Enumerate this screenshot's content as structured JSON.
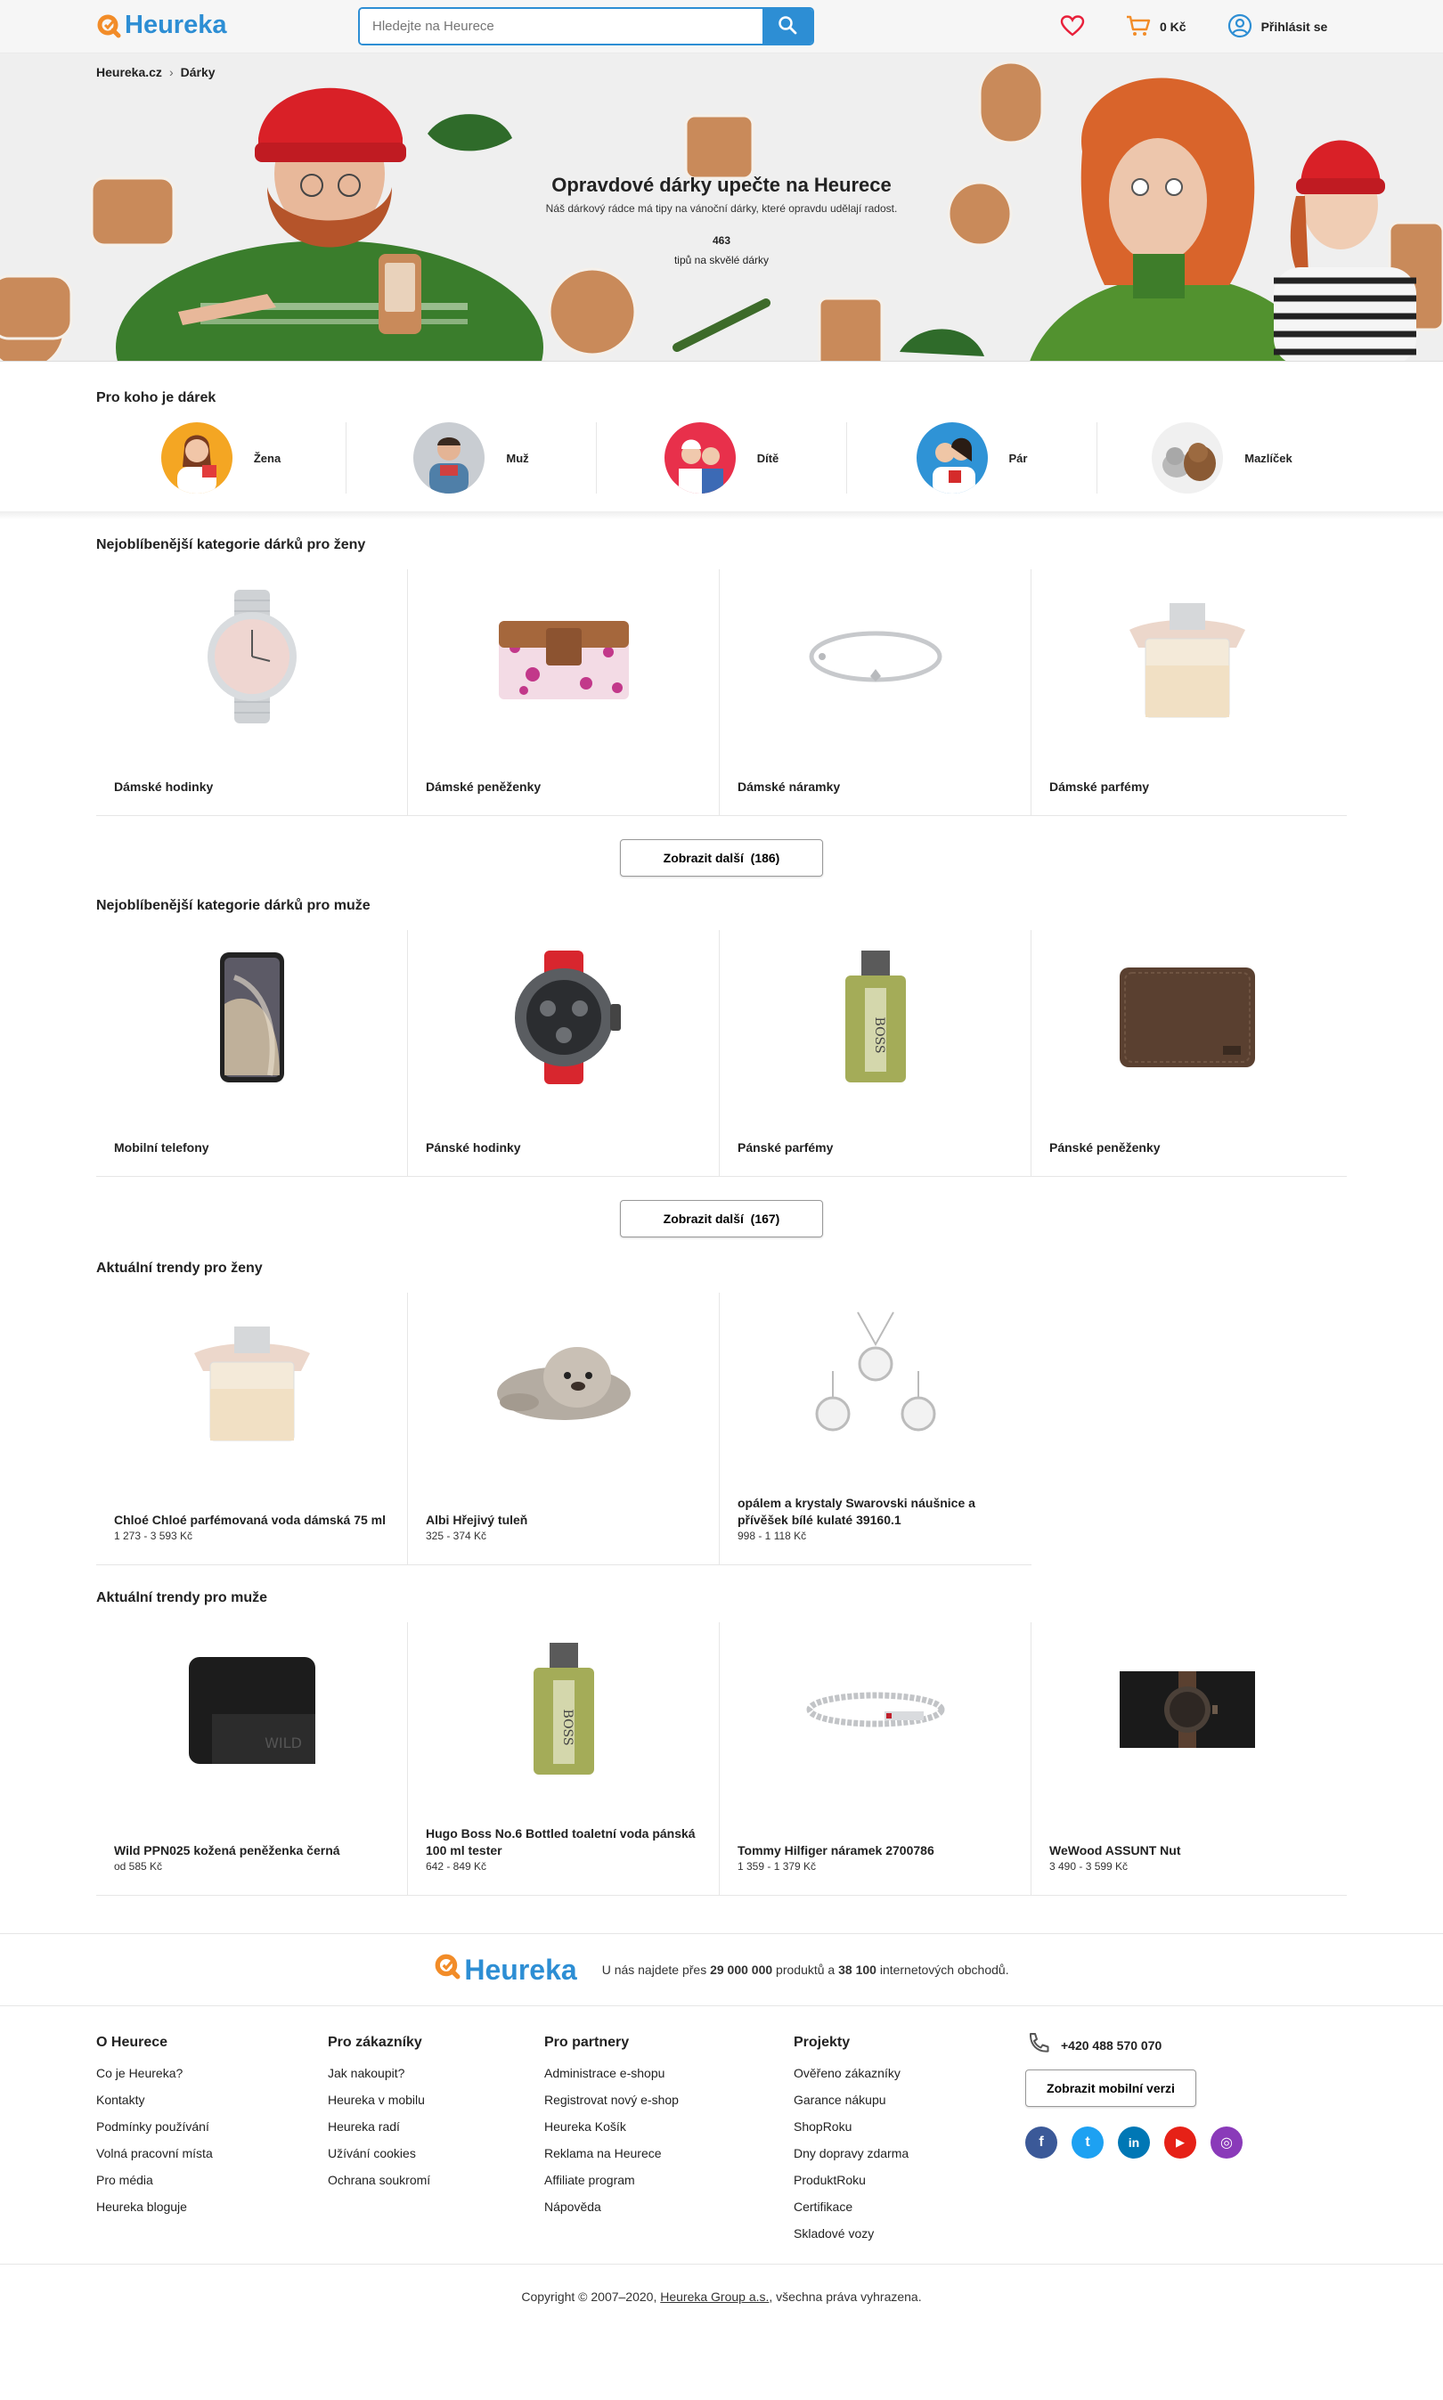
{
  "header": {
    "logo_text": "Heureka",
    "search_placeholder": "Hledejte na Heurece",
    "cart_total": "0 Kč",
    "login_label": "Přihlásit se",
    "accent_color": "#2d8ed4",
    "icons": [
      "heart-icon",
      "cart-icon",
      "user-icon",
      "search-icon"
    ]
  },
  "breadcrumb": [
    "Heureka.cz",
    "Dárky"
  ],
  "hero": {
    "title": "Opravdové dárky upečte na Heurece",
    "subtitle": "Náš dárkový rádce má tipy na vánoční dárky, které opravdu udělají radost.",
    "count": "463",
    "count_label": "tipů na skvělé dárky"
  },
  "recipients": {
    "title": "Pro koho je dárek",
    "items": [
      {
        "label": "Žena"
      },
      {
        "label": "Muž"
      },
      {
        "label": "Dítě"
      },
      {
        "label": "Pár"
      },
      {
        "label": "Mazlíček"
      }
    ]
  },
  "women_categories": {
    "title": "Nejoblíbenější kategorie dárků pro ženy",
    "items": [
      {
        "label": "Dámské hodinky"
      },
      {
        "label": "Dámské peněženky"
      },
      {
        "label": "Dámské náramky"
      },
      {
        "label": "Dámské parfémy"
      }
    ],
    "more_label": "Zobrazit další",
    "more_count": "(186)"
  },
  "men_categories": {
    "title": "Nejoblíbenější kategorie dárků pro muže",
    "items": [
      {
        "label": "Mobilní telefony"
      },
      {
        "label": "Pánské hodinky"
      },
      {
        "label": "Pánské parfémy"
      },
      {
        "label": "Pánské peněženky"
      }
    ],
    "more_label": "Zobrazit další",
    "more_count": "(167)"
  },
  "women_trends": {
    "title": "Aktuální trendy pro ženy",
    "items": [
      {
        "name": "Chloé Chloé parfémovaná voda dámská 75 ml",
        "price": "1 273 - 3 593 Kč"
      },
      {
        "name": "Albi Hřejivý tuleň",
        "price": "325 - 374 Kč"
      },
      {
        "name": "opálem a krystaly Swarovski náušnice a přívěšek bílé kulaté 39160.1",
        "price": "998 - 1 118 Kč"
      }
    ]
  },
  "men_trends": {
    "title": "Aktuální trendy pro muže",
    "items": [
      {
        "name": "Wild PPN025 kožená peněženka černá",
        "price": "od 585 Kč"
      },
      {
        "name": "Hugo Boss No.6 Bottled toaletní voda pánská 100 ml tester",
        "price": "642 - 849 Kč"
      },
      {
        "name": "Tommy Hilfiger náramek 2700786",
        "price": "1 359 - 1 379 Kč"
      },
      {
        "name": "WeWood ASSUNT Nut",
        "price": "3 490 - 3 599 Kč"
      }
    ]
  },
  "promo": {
    "logo_text": "Heureka",
    "text_pre": "U nás najdete přes ",
    "products": "29 000 000",
    "text_mid": " produktů a ",
    "shops": "38 100",
    "text_post": " internetových obchodů."
  },
  "footer": {
    "columns": [
      {
        "title": "O Heurece",
        "links": [
          "Co je Heureka?",
          "Kontakty",
          "Podmínky používání",
          "Volná pracovní místa",
          "Pro média",
          "Heureka bloguje"
        ]
      },
      {
        "title": "Pro zákazníky",
        "links": [
          "Jak nakoupit?",
          "Heureka v mobilu",
          "Heureka radí",
          "Užívání cookies",
          "Ochrana soukromí"
        ]
      },
      {
        "title": "Pro partnery",
        "links": [
          "Administrace e-shopu",
          "Registrovat nový e-shop",
          "Heureka Košík",
          "Reklama na Heurece",
          "Affiliate program",
          "Nápověda"
        ]
      },
      {
        "title": "Projekty",
        "links": [
          "Ověřeno zákazníky",
          "Garance nákupu",
          "ShopRoku",
          "Dny dopravy zdarma",
          "ProduktRoku",
          "Certifikace",
          "Skladové vozy"
        ]
      }
    ],
    "phone": "+420 488 570 070",
    "mobile_button": "Zobrazit mobilní verzi",
    "social": [
      {
        "name": "facebook-icon",
        "glyph": "f",
        "color": "#3b5998"
      },
      {
        "name": "twitter-icon",
        "glyph": "t",
        "color": "#1da1f2"
      },
      {
        "name": "linkedin-icon",
        "glyph": "in",
        "color": "#0077b5"
      },
      {
        "name": "youtube-icon",
        "glyph": "▶",
        "color": "#e62117"
      },
      {
        "name": "instagram-icon",
        "glyph": "◎",
        "color": "#8a3ab9"
      }
    ]
  },
  "copyright": {
    "pre": "Copyright © 2007–2020, ",
    "company": "Heureka Group a.s.",
    "post": ", všechna práva vyhrazena."
  }
}
